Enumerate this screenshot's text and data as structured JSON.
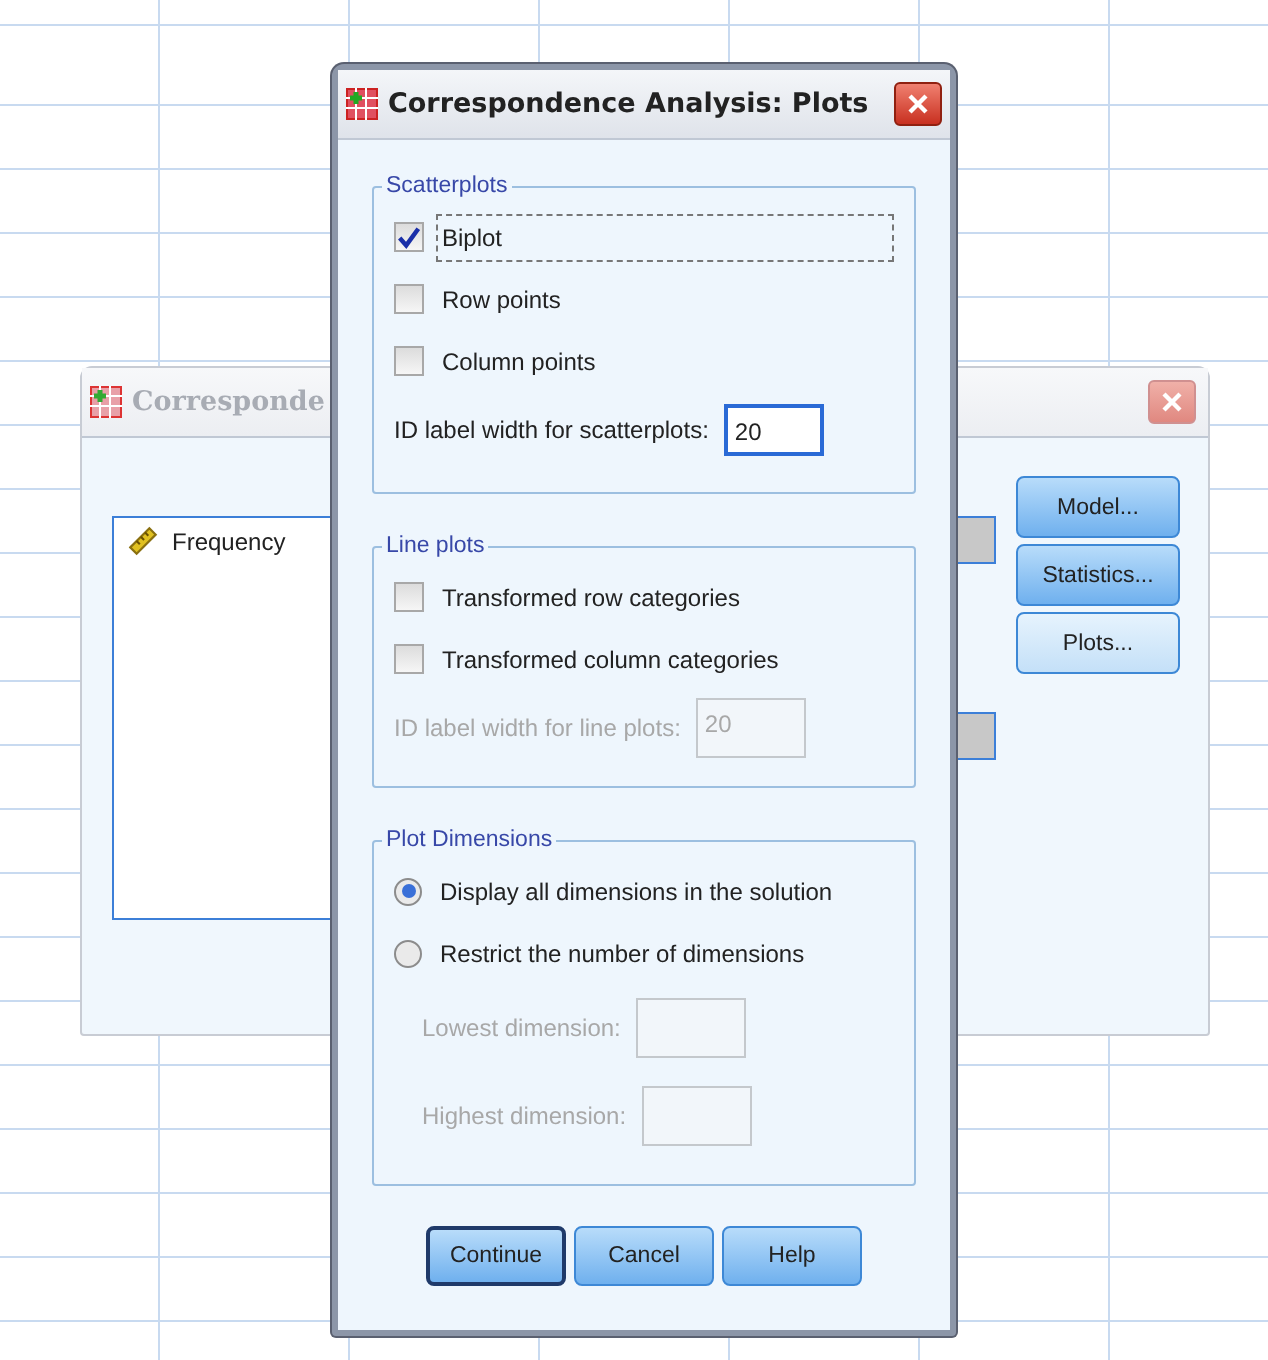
{
  "background_window": {
    "title": "Corresponde",
    "variables": [
      {
        "name": "Frequency"
      }
    ],
    "buttons": [
      "Model...",
      "Statistics...",
      "Plots..."
    ]
  },
  "dialog": {
    "title": "Correspondence Analysis: Plots",
    "sections": [
      {
        "kind": "checks",
        "legend": "Scatterplots",
        "options": [
          {
            "label": "Biplot",
            "checked": true,
            "focused": true
          },
          {
            "label": "Row points",
            "checked": false,
            "focused": false
          },
          {
            "label": "Column points",
            "checked": false,
            "focused": false
          }
        ],
        "fields": [
          {
            "label": "ID label width for scatterplots:",
            "value": "20",
            "disabled": false
          }
        ]
      },
      {
        "kind": "checks",
        "legend": "Line plots",
        "options": [
          {
            "label": "Transformed row categories",
            "checked": false,
            "focused": false
          },
          {
            "label": "Transformed column categories",
            "checked": false,
            "focused": false
          }
        ],
        "fields": [
          {
            "label": "ID label width for line plots:",
            "value": "20",
            "disabled": true
          }
        ]
      },
      {
        "kind": "radios",
        "legend": "Plot Dimensions",
        "options": [
          {
            "label": "Display all dimensions in the solution",
            "selected": true
          },
          {
            "label": "Restrict the number of dimensions",
            "selected": false
          }
        ],
        "fields": [
          {
            "label": "Lowest dimension:",
            "disabled": true
          },
          {
            "label": "Highest dimension:",
            "disabled": true
          }
        ]
      }
    ],
    "buttons": [
      {
        "label": "Continue",
        "default": true
      },
      {
        "label": "Cancel",
        "default": false
      },
      {
        "label": "Help",
        "default": false
      }
    ]
  }
}
